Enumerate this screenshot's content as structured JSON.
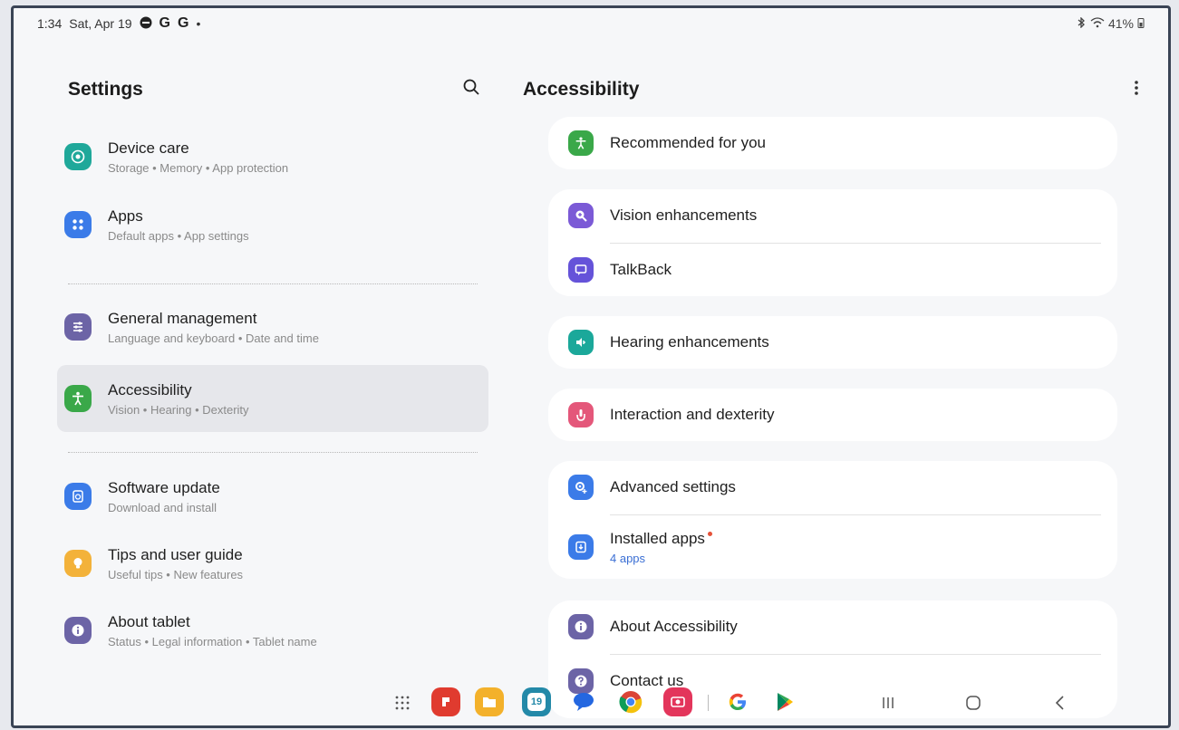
{
  "status_bar": {
    "time": "1:34",
    "date": "Sat, Apr 19",
    "notification_glyphs": [
      "G",
      "G"
    ],
    "battery": "41%"
  },
  "left_pane": {
    "title": "Settings",
    "items": [
      {
        "title": "Device care",
        "subtitle": "Storage  •  Memory  •  App protection",
        "icon": "device-care-icon",
        "color": "#1fa89a"
      },
      {
        "title": "Apps",
        "subtitle": "Default apps  •  App settings",
        "icon": "apps-icon",
        "color": "#3b7be8"
      },
      {
        "title": "General management",
        "subtitle": "Language and keyboard  •  Date and time",
        "icon": "sliders-icon",
        "color": "#6c64a6"
      },
      {
        "title": "Accessibility",
        "subtitle": "Vision  •  Hearing  •  Dexterity",
        "icon": "accessibility-icon",
        "color": "#3aa849"
      },
      {
        "title": "Software update",
        "subtitle": "Download and install",
        "icon": "software-update-icon",
        "color": "#3b7be8"
      },
      {
        "title": "Tips and user guide",
        "subtitle": "Useful tips  •  New features",
        "icon": "lightbulb-icon",
        "color": "#f3b23a"
      },
      {
        "title": "About tablet",
        "subtitle": "Status  •  Legal information  •  Tablet name",
        "icon": "info-icon",
        "color": "#6c64a6"
      }
    ]
  },
  "right_pane": {
    "title": "Accessibility",
    "rows": [
      {
        "label": "Recommended for you",
        "icon": "accessibility-person-icon",
        "color": "#3aa849"
      },
      {
        "label": "Vision enhancements",
        "icon": "magnifier-icon",
        "color": "#7b5ad6"
      },
      {
        "label": "TalkBack",
        "icon": "talkback-icon",
        "color": "#6553d9"
      },
      {
        "label": "Hearing enhancements",
        "icon": "hearing-icon",
        "color": "#1ba89a"
      },
      {
        "label": "Interaction and dexterity",
        "icon": "hand-touch-icon",
        "color": "#e4577a"
      },
      {
        "label": "Advanced settings",
        "icon": "gear-plus-icon",
        "color": "#3b7be8"
      },
      {
        "label": "Installed apps",
        "sublabel": "4 apps",
        "icon": "installed-apps-icon",
        "color": "#3b7be8"
      },
      {
        "label": "About Accessibility",
        "icon": "info-icon",
        "color": "#6c64a6"
      },
      {
        "label": "Contact us",
        "icon": "help-icon",
        "color": "#6c64a6"
      }
    ]
  },
  "dock": {
    "apps": [
      {
        "name": "flipboard-icon",
        "color": "#e03b2f"
      },
      {
        "name": "my-files-icon",
        "color": "#f3b12b"
      },
      {
        "name": "calendar-icon",
        "color": "#2389a8",
        "label": "19"
      },
      {
        "name": "messages-icon",
        "color": "#2467e0"
      },
      {
        "name": "chrome-icon",
        "color": "#34a853"
      },
      {
        "name": "gallery-icon",
        "color": "#e3355b"
      },
      {
        "name": "google-icon",
        "color": "#4285f4"
      },
      {
        "name": "play-store-icon",
        "color": "#01875f"
      }
    ]
  }
}
